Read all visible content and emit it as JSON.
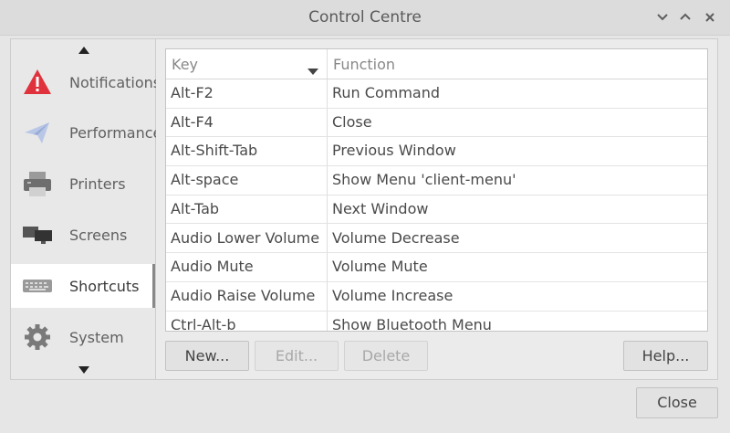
{
  "window": {
    "title": "Control Centre",
    "minimize_icon": "chevron-down-icon",
    "maximize_icon": "chevron-up-icon",
    "close_icon": "close-icon"
  },
  "sidebar": {
    "items": [
      {
        "label": "Notifications",
        "icon": "warning-icon"
      },
      {
        "label": "Performance",
        "icon": "paper-plane-icon"
      },
      {
        "label": "Printers",
        "icon": "printer-icon"
      },
      {
        "label": "Screens",
        "icon": "monitors-icon"
      },
      {
        "label": "Shortcuts",
        "icon": "keyboard-icon",
        "selected": true
      },
      {
        "label": "System",
        "icon": "gear-icon"
      }
    ]
  },
  "table": {
    "columns": [
      "Key",
      "Function"
    ],
    "sort_column": "Key",
    "rows": [
      [
        "Alt-F2",
        "Run Command"
      ],
      [
        "Alt-F4",
        "Close"
      ],
      [
        "Alt-Shift-Tab",
        "Previous Window"
      ],
      [
        "Alt-space",
        "Show Menu 'client-menu'"
      ],
      [
        "Alt-Tab",
        "Next Window"
      ],
      [
        "Audio Lower Volume",
        "Volume Decrease"
      ],
      [
        "Audio Mute",
        "Volume Mute"
      ],
      [
        "Audio Raise Volume",
        "Volume Increase"
      ],
      [
        "Ctrl-Alt-b",
        "Show Bluetooth Menu"
      ]
    ]
  },
  "buttons": {
    "new": "New...",
    "edit": "Edit...",
    "delete": "Delete",
    "help": "Help...",
    "close": "Close"
  },
  "colors": {
    "warning_red": "#e0323c",
    "selection_bg": "#ffffff"
  }
}
